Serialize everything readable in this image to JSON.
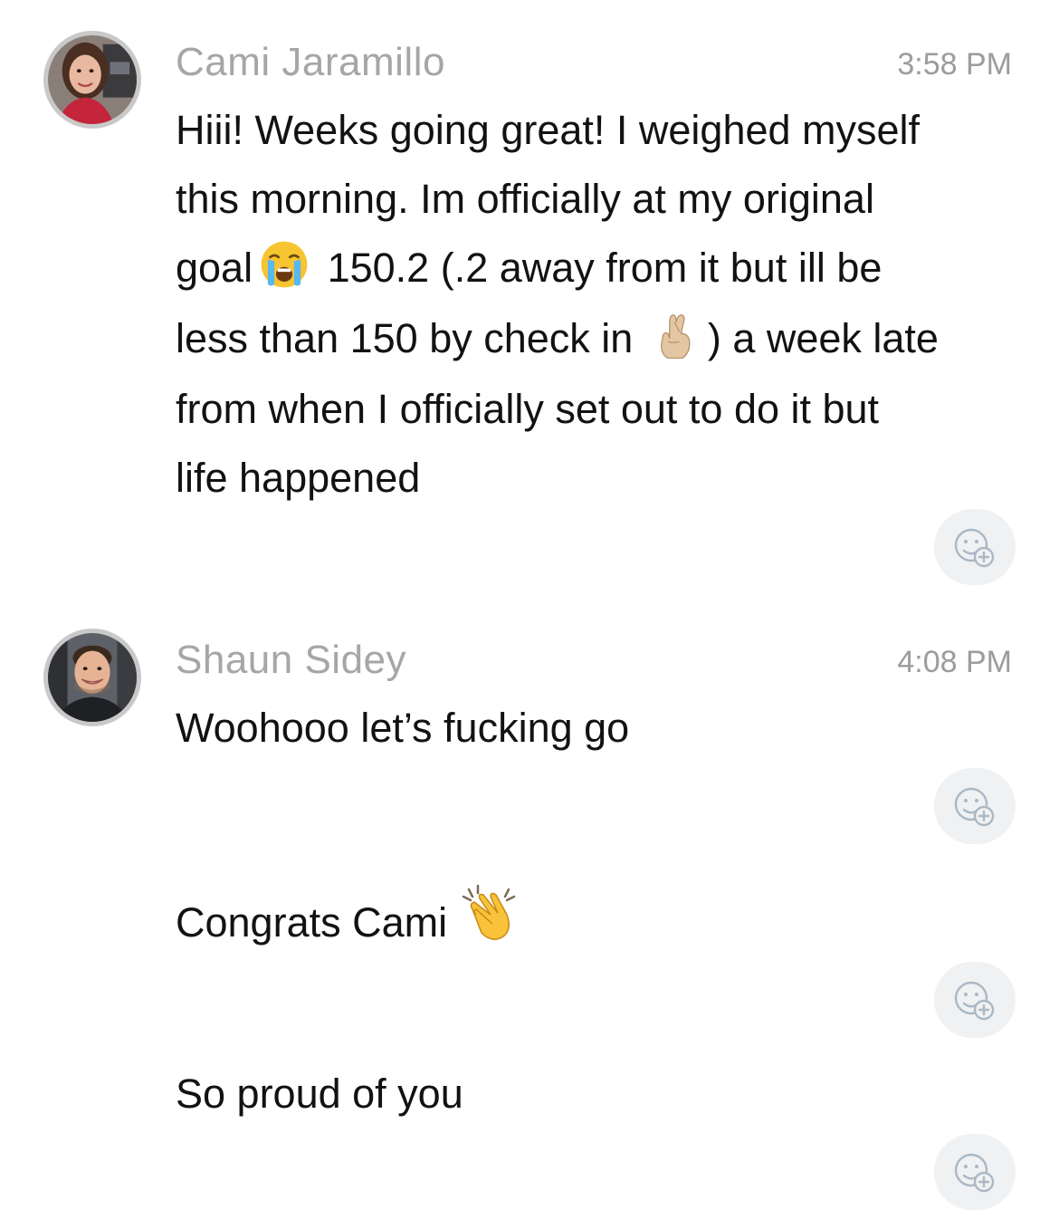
{
  "messages": [
    {
      "sender": "Cami Jaramillo",
      "time": "3:58 PM",
      "avatar_icon": "avatar-photo-cami",
      "lines": [
        {
          "parts": [
            "Hiii! Weeks going great! I weighed myself"
          ]
        },
        {
          "parts": [
            "this morning. Im officially at my original"
          ]
        },
        {
          "before": "goal",
          "emoji": "loudly-crying-face-emoji",
          "after": "150.2 (.2 away from it but ill be"
        },
        {
          "before": "less than 150 by check in",
          "emoji": "crossed-fingers-emoji",
          "after": ") a week late"
        },
        {
          "parts": [
            "from when I officially set out to do it but"
          ]
        },
        {
          "parts": [
            "life happened"
          ]
        }
      ]
    },
    {
      "sender": "Shaun Sidey",
      "time": "4:08 PM",
      "avatar_icon": "avatar-photo-shaun",
      "texts": [
        "Woohooo let’s fucking go",
        "Congrats Cami",
        "So proud of you"
      ],
      "clap_emoji": "clapping-hands-emoji"
    }
  ],
  "reaction_button_icon": "add-reaction-icon",
  "colors": {
    "sender_name": "#a6a6a6",
    "timestamp": "#9c9c9c",
    "message_text": "#121212",
    "reaction_bg": "#f0f1f2",
    "reaction_icon": "#a9b8c6",
    "avatar_ring": "#c9c9c9"
  }
}
